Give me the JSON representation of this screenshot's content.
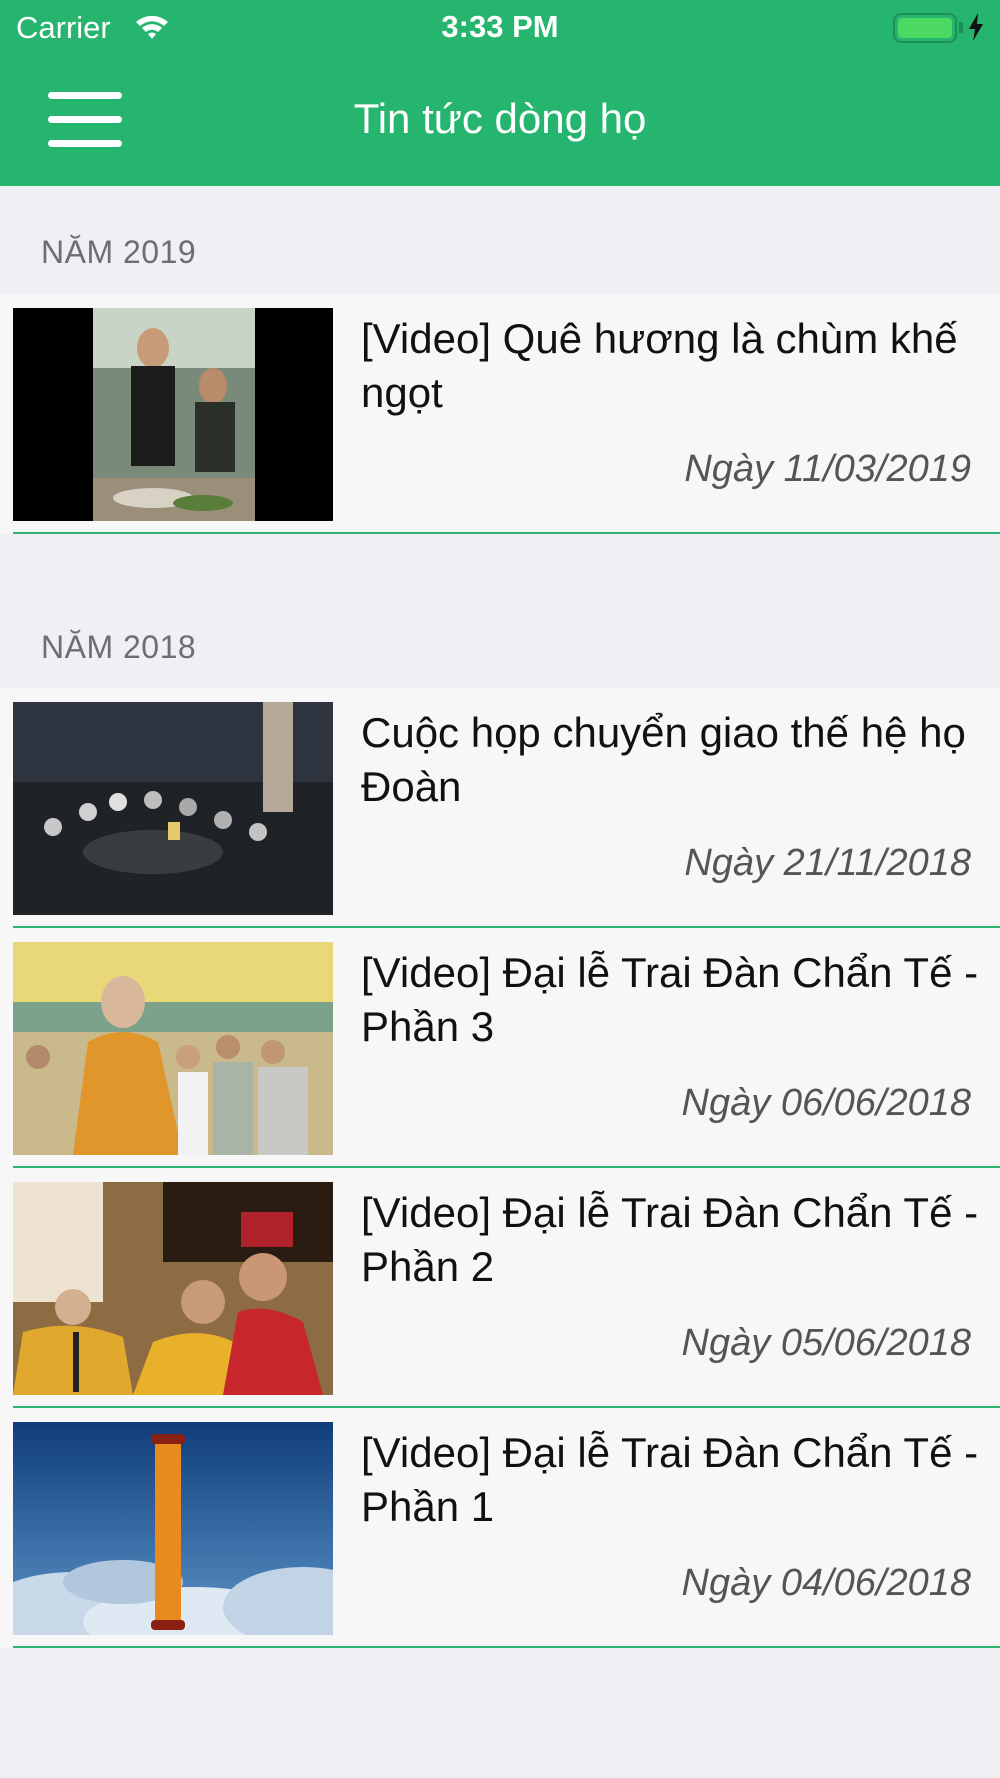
{
  "status_bar": {
    "carrier": "Carrier",
    "time": "3:33 PM",
    "battery_color": "#4cd964"
  },
  "nav_bar": {
    "title": "Tin tức dòng họ",
    "menu_icon": "hamburger-menu-icon",
    "background_color": "#25b56f"
  },
  "sections": [
    {
      "header": "NĂM 2019",
      "items": [
        {
          "title": "[Video] Quê hương là chùm khế ngọt",
          "date": "Ngày 11/03/2019"
        }
      ]
    },
    {
      "header": "NĂM 2018",
      "items": [
        {
          "title": "Cuộc họp chuyển giao thế hệ họ Đoàn",
          "date": "Ngày 21/11/2018"
        },
        {
          "title": "[Video] Đại lễ Trai Đàn Chẩn Tế - Phần 3",
          "date": "Ngày 06/06/2018"
        },
        {
          "title": "[Video] Đại lễ Trai Đàn Chẩn Tế - Phần 2",
          "date": "Ngày 05/06/2018"
        },
        {
          "title": "[Video] Đại lễ Trai Đàn Chẩn Tế - Phần 1",
          "date": "Ngày 04/06/2018"
        }
      ]
    }
  ],
  "accent_color": "#2fb572"
}
